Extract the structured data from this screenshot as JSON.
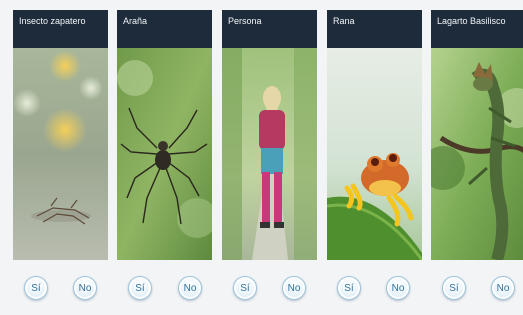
{
  "cards": [
    {
      "title": "Insecto zapatero",
      "icon": "water-strider-photo"
    },
    {
      "title": "Araña",
      "icon": "spider-photo"
    },
    {
      "title": "Persona",
      "icon": "person-photo"
    },
    {
      "title": "Rana",
      "icon": "frog-photo"
    },
    {
      "title": "Lagarto Basilisco",
      "icon": "basilisk-lizard-photo"
    }
  ],
  "buttons": {
    "yes_label": "Sí",
    "no_label": "No"
  },
  "colors": {
    "header_bg": "#1d2b3a",
    "button_text": "#2e6f95",
    "page_bg": "#f3f4f6"
  }
}
